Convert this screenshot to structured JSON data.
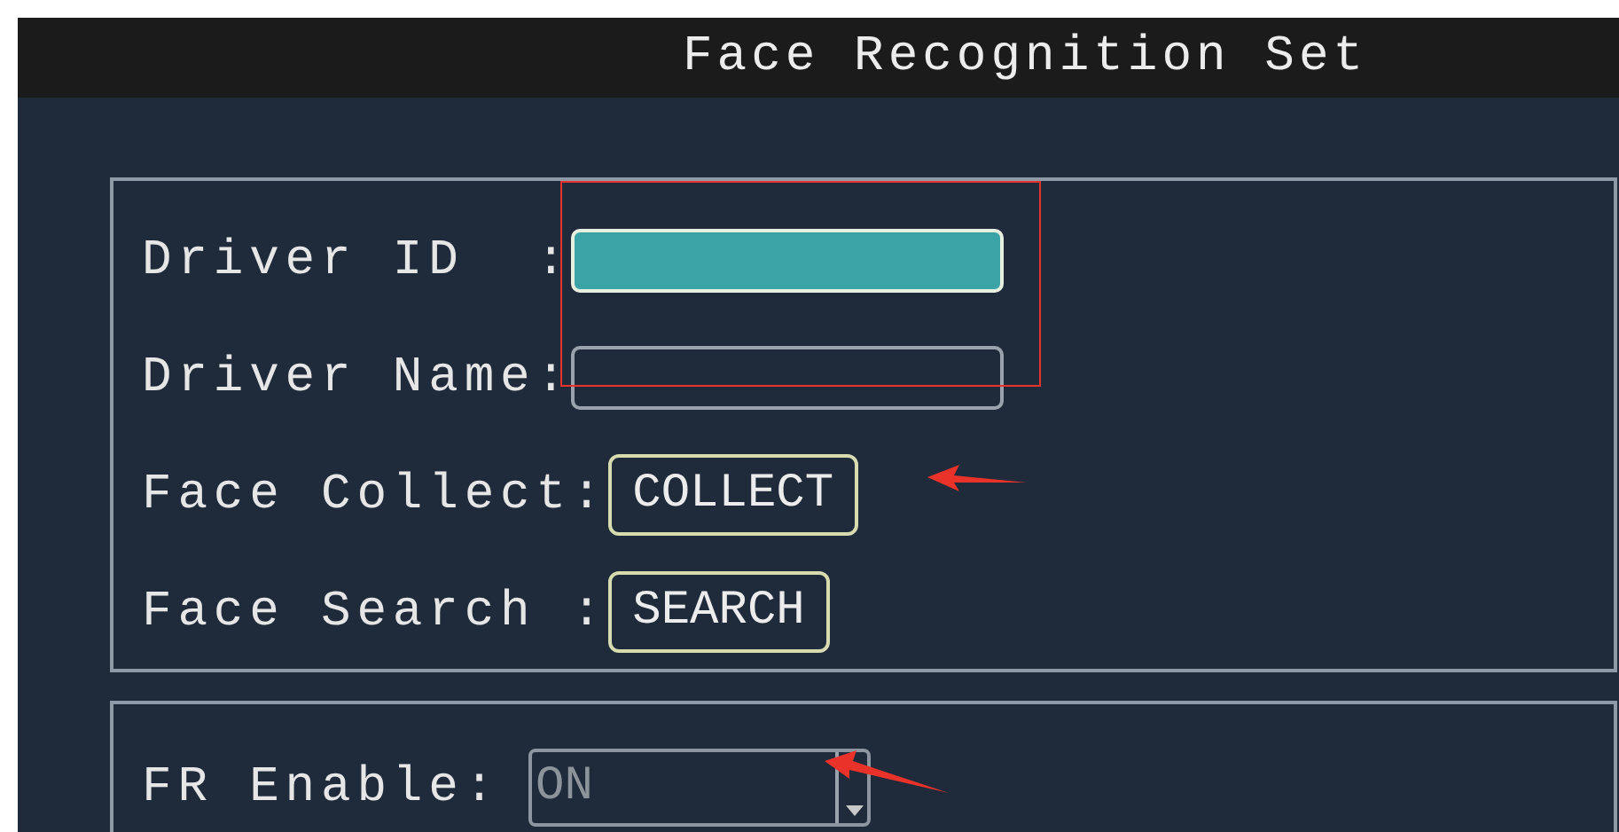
{
  "window": {
    "title": "Face Recognition Set"
  },
  "rows": [
    {
      "kind": "field",
      "label": "Driver ID  :",
      "selected": true
    },
    {
      "kind": "field",
      "label": "Driver Name:",
      "selected": false
    },
    {
      "kind": "button",
      "label": "Face Collect:",
      "button": "COLLECT"
    },
    {
      "kind": "button",
      "label": "Face Search :",
      "button": "SEARCH"
    }
  ],
  "fr_enable": {
    "label": "FR Enable:",
    "value": "ON",
    "disabled": true
  }
}
